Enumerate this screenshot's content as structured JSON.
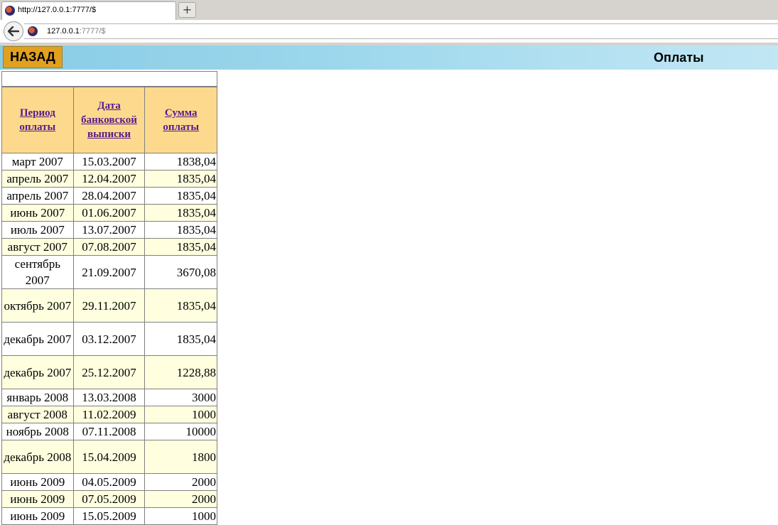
{
  "browser": {
    "tab_title": "http://127.0.0.1:7777/$",
    "new_tab_label": "+",
    "url_host": "127.0.0.1",
    "url_rest": ":7777/$"
  },
  "header": {
    "back_label": "НАЗАД",
    "title": "Оплаты"
  },
  "table": {
    "headers": {
      "period": "Период оплаты",
      "date": "Дата банковской выписки",
      "sum": "Сумма оплаты"
    },
    "rows": [
      {
        "period": "март 2007",
        "date": "15.03.2007",
        "sum": "1838,04"
      },
      {
        "period": "апрель 2007",
        "date": "12.04.2007",
        "sum": "1835,04"
      },
      {
        "period": "апрель 2007",
        "date": "28.04.2007",
        "sum": "1835,04"
      },
      {
        "period": "июнь 2007",
        "date": "01.06.2007",
        "sum": "1835,04"
      },
      {
        "period": "июль 2007",
        "date": "13.07.2007",
        "sum": "1835,04"
      },
      {
        "period": "август 2007",
        "date": "07.08.2007",
        "sum": "1835,04"
      },
      {
        "period": "сентябрь 2007",
        "date": "21.09.2007",
        "sum": "3670,08"
      },
      {
        "period": "октябрь 2007",
        "date": "29.11.2007",
        "sum": "1835,04"
      },
      {
        "period": "декабрь 2007",
        "date": "03.12.2007",
        "sum": "1835,04"
      },
      {
        "period": "декабрь 2007",
        "date": "25.12.2007",
        "sum": "1228,88"
      },
      {
        "period": "январь 2008",
        "date": "13.03.2008",
        "sum": "3000"
      },
      {
        "period": "август 2008",
        "date": "11.02.2009",
        "sum": "1000"
      },
      {
        "period": "ноябрь 2008",
        "date": "07.11.2008",
        "sum": "10000"
      },
      {
        "period": "декабрь 2008",
        "date": "15.04.2009",
        "sum": "1800"
      },
      {
        "period": "июнь 2009",
        "date": "04.05.2009",
        "sum": "2000"
      },
      {
        "period": "июнь 2009",
        "date": "07.05.2009",
        "sum": "2000"
      },
      {
        "period": "июнь 2009",
        "date": "15.05.2009",
        "sum": "1000"
      }
    ]
  }
}
